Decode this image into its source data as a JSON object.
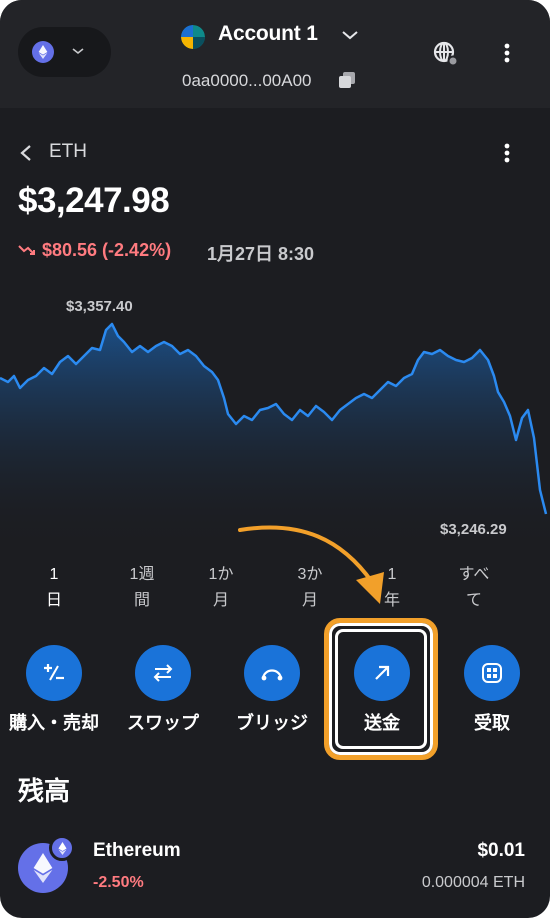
{
  "header": {
    "account_name": "Account 1",
    "account_address": "0aa0000...00A00"
  },
  "asset": {
    "title": "ETH",
    "price": "$3,247.98",
    "change": "$80.56 (-2.42%)",
    "change_time": "1月27日 8:30",
    "chart_high_label": "$3,357.40",
    "chart_low_label": "$3,246.29"
  },
  "ranges": [
    {
      "line1": "1",
      "line2": "日"
    },
    {
      "line1": "1週",
      "line2": "間"
    },
    {
      "line1": "1か",
      "line2": "月"
    },
    {
      "line1": "3か",
      "line2": "月"
    },
    {
      "line1": "1",
      "line2": "年"
    },
    {
      "line1": "すべ",
      "line2": "て"
    }
  ],
  "actions": {
    "buy_sell": "購入・売却",
    "swap": "スワップ",
    "bridge": "ブリッジ",
    "send": "送金",
    "receive": "受取"
  },
  "balance": {
    "title": "残高",
    "token_name": "Ethereum",
    "token_change": "-2.50%",
    "token_value": "$0.01",
    "token_amount": "0.000004 ETH"
  },
  "colors": {
    "background": "#1c1d21",
    "accent_blue": "#1a73d9",
    "negative": "#ff7b80",
    "highlight_orange": "#f2a02a",
    "eth_purple": "#6470e8"
  }
}
